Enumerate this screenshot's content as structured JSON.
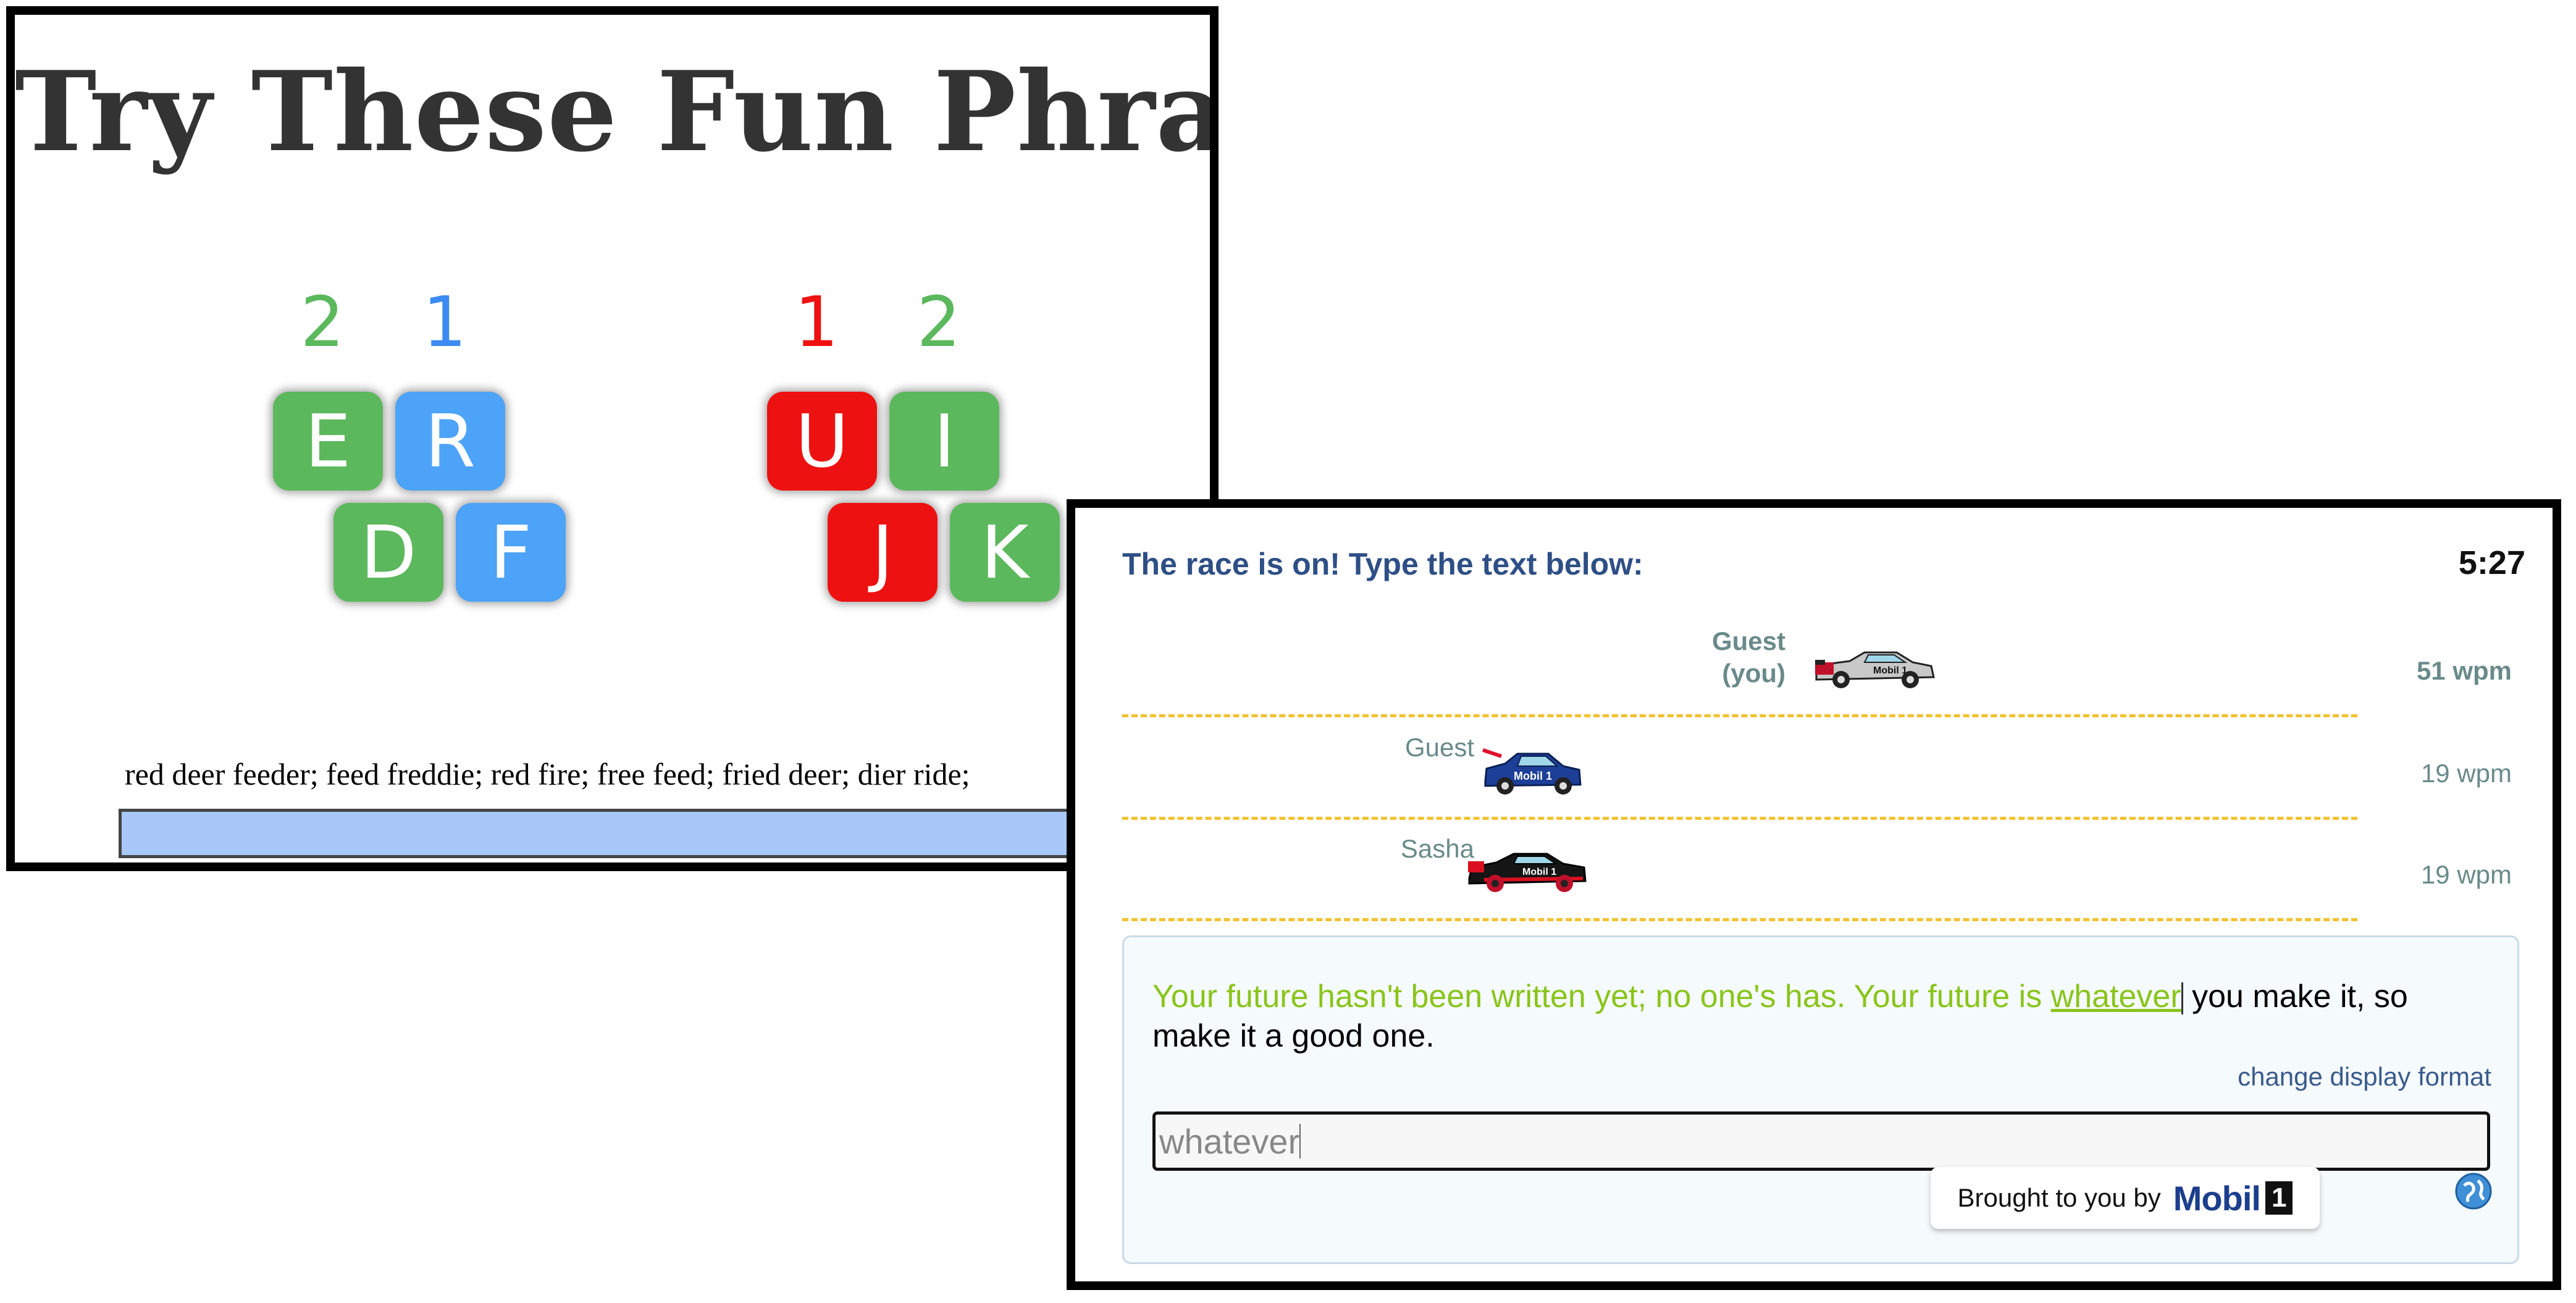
{
  "lesson": {
    "title": "Try These Fun Phrases",
    "left_hand": {
      "finger_numbers": [
        "2",
        "1"
      ],
      "keys_top": [
        "E",
        "R"
      ],
      "keys_bottom": [
        "D",
        "F"
      ]
    },
    "right_hand": {
      "finger_numbers": [
        "1",
        "2"
      ],
      "keys_top": [
        "U",
        "I"
      ],
      "keys_bottom": [
        "J",
        "K"
      ]
    },
    "practice_text": "red deer feeder; feed freddie; red fire; free feed; fried deer; dier ride;",
    "colors": {
      "green": "#5cb85c",
      "blue": "#4da3f7",
      "red": "#ee1111",
      "num_green": "#5cb85c",
      "num_blue": "#3d8bf2",
      "num_red": "#ee1111"
    }
  },
  "race": {
    "header": "The race is on! Type the text below:",
    "timer": "5:27",
    "racers": [
      {
        "name_line1": "Guest",
        "name_line2": "(you)",
        "wpm": "51 wpm",
        "car_icon": "silver-racecar-icon",
        "progress": 0.55
      },
      {
        "name_line1": "Guest",
        "name_line2": "",
        "wpm": "19 wpm",
        "car_icon": "blue-racecar-icon",
        "progress": 0.28
      },
      {
        "name_line1": "Sasha",
        "name_line2": "",
        "wpm": "19 wpm",
        "car_icon": "black-racecar-icon",
        "progress": 0.28
      }
    ],
    "passage": {
      "typed": "Your future hasn't been written yet; no one's has. Your future is ",
      "current_word": "whatever",
      "remaining": " you make it, so make it a good one."
    },
    "change_format_label": "change display format",
    "input_value": "whatever",
    "sponsor": {
      "prefix": "Brought to you by",
      "brand": "Mobil",
      "brand_suffix": "1"
    },
    "help_icon": "globe-help-icon",
    "colors": {
      "header": "#2e4f86",
      "typed": "#8ac41a",
      "lane_separator": "#f2c230",
      "muted": "#6a8a8a"
    }
  }
}
